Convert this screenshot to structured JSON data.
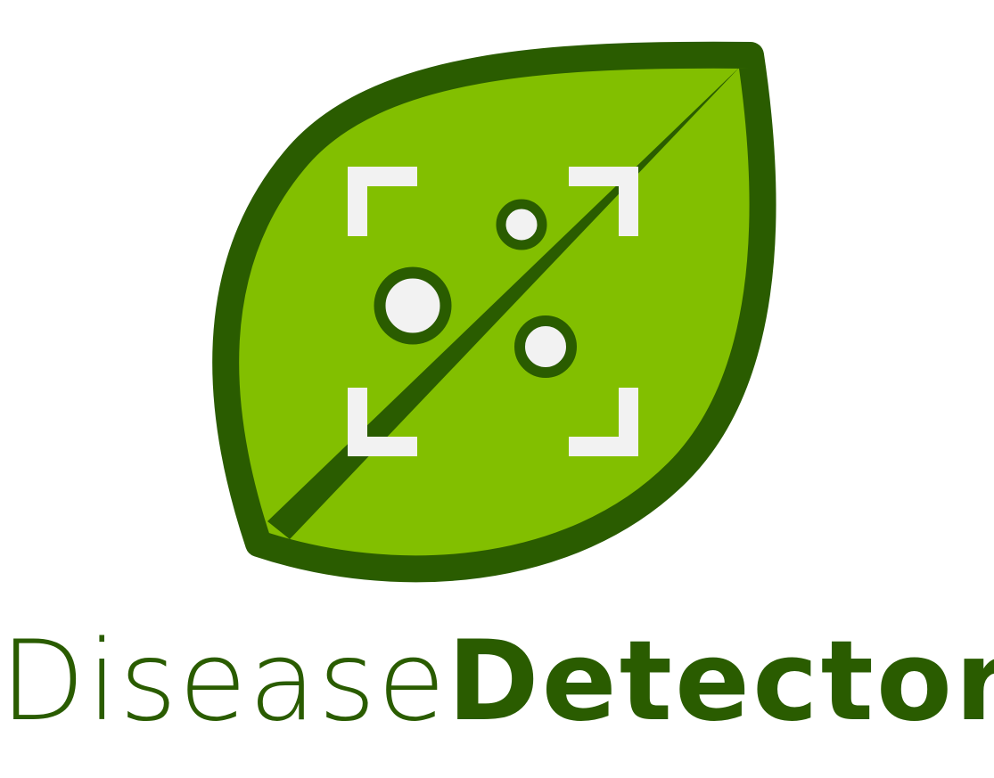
{
  "logo": {
    "name_part_light": "Disease",
    "name_part_bold": "Detector",
    "icon": "leaf-scan-icon"
  },
  "colors": {
    "leaf_fill": "#82bf00",
    "leaf_outline": "#2a5c00",
    "scan_marks": "#f2f2f2",
    "spot_fill": "#f2f2f2",
    "spot_outline": "#2a5c00",
    "wordmark": "#2a5c00",
    "background": "#ffffff"
  }
}
